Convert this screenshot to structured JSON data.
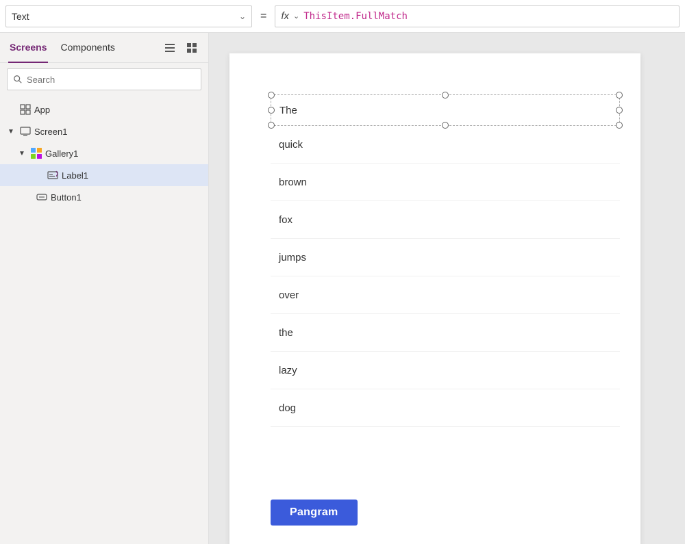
{
  "topbar": {
    "property_label": "Text",
    "equals": "=",
    "fx_label": "fx",
    "chevron": "∨",
    "formula": "ThisItem.FullMatch"
  },
  "tabs": {
    "screens_label": "Screens",
    "components_label": "Components",
    "active": "screens"
  },
  "search": {
    "placeholder": "Search"
  },
  "tree": {
    "items": [
      {
        "id": "app",
        "label": "App",
        "indent": 0,
        "type": "app",
        "expand": "none"
      },
      {
        "id": "screen1",
        "label": "Screen1",
        "indent": 1,
        "type": "screen",
        "expand": "open"
      },
      {
        "id": "gallery1",
        "label": "Gallery1",
        "indent": 2,
        "type": "gallery",
        "expand": "open"
      },
      {
        "id": "label1",
        "label": "Label1",
        "indent": 3,
        "type": "label",
        "expand": "none",
        "selected": true
      },
      {
        "id": "button1",
        "label": "Button1",
        "indent": 2,
        "type": "button",
        "expand": "none"
      }
    ]
  },
  "canvas": {
    "selected_text": "The",
    "words": [
      "quick",
      "brown",
      "fox",
      "jumps",
      "over",
      "the",
      "lazy",
      "dog"
    ],
    "button_label": "Pangram"
  }
}
